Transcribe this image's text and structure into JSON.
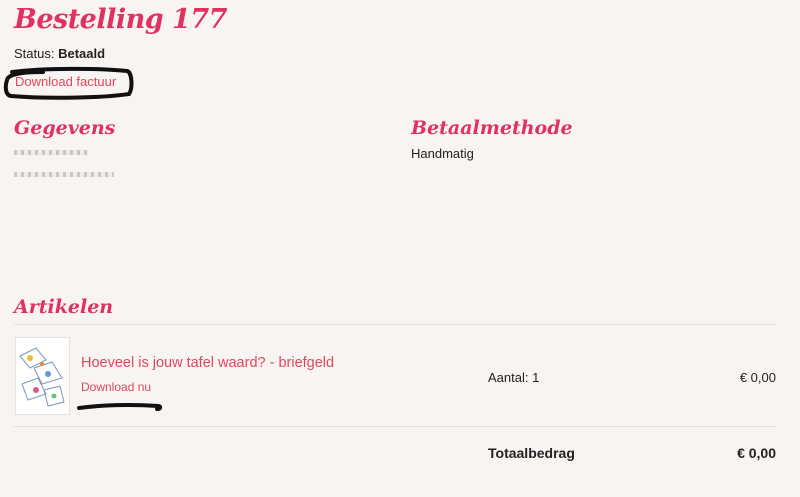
{
  "order": {
    "title": "Bestelling 177",
    "status_label": "Status:",
    "status_value": "Betaald",
    "invoice_link": "Download factuur"
  },
  "details": {
    "heading": "Gegevens"
  },
  "payment": {
    "heading": "Betaalmethode",
    "method": "Handmatig"
  },
  "articles": {
    "heading": "Artikelen",
    "items": [
      {
        "name": "Hoeveel is jouw tafel waard? - briefgeld",
        "download_label": "Download nu",
        "quantity": "Aantal: 1",
        "price": "€ 0,00"
      }
    ],
    "total_label": "Totaalbedrag",
    "total_value": "€ 0,00"
  },
  "colors": {
    "accent": "#e0315f",
    "link": "#e3475c",
    "background": "#f7f4f2"
  }
}
